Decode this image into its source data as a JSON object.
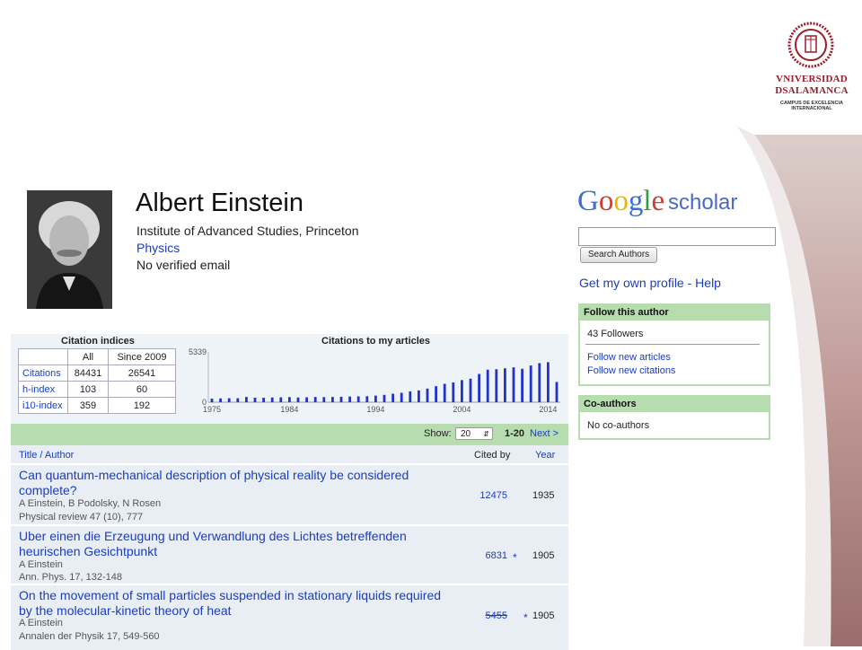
{
  "profile": {
    "name": "Albert Einstein",
    "affiliation": "Institute of Advanced Studies, Princeton",
    "field": "Physics",
    "email_status": "No verified email"
  },
  "university": {
    "line1": "VNIVERSIDAD",
    "line2": "DSALAMANCA",
    "line3": "CAMPUS DE EXCELENCIA",
    "line4": "INTERNACIONAL",
    "accent_color": "#9c1c26"
  },
  "scholar": {
    "logo_letters": [
      "G",
      "o",
      "o",
      "g",
      "l",
      "e"
    ],
    "logo_colors": [
      "#3b6fd6",
      "#d63b2f",
      "#f0b400",
      "#3b6fd6",
      "#2e9e3e",
      "#d63b2f"
    ],
    "logo_suffix": "scholar",
    "search_value": "",
    "search_button": "Search Authors",
    "own_profile": "Get my own profile",
    "separator": "-",
    "help": "Help"
  },
  "follow": {
    "header": "Follow this author",
    "followers": "43 Followers",
    "new_articles": "Follow new articles",
    "new_citations": "Follow new citations"
  },
  "coauthors": {
    "header": "Co-authors",
    "empty": "No co-authors"
  },
  "citation_indices": {
    "title": "Citation indices",
    "col_all": "All",
    "col_since": "Since 2009",
    "rows": [
      {
        "label": "Citations",
        "all": "84431",
        "since": "26541"
      },
      {
        "label": "h-index",
        "all": "103",
        "since": "60"
      },
      {
        "label": "i10-index",
        "all": "359",
        "since": "192"
      }
    ]
  },
  "chart_data": {
    "type": "bar",
    "title": "Citations to my articles",
    "ymax_label": "5339",
    "ymin_label": "0",
    "ylim": [
      0,
      5339
    ],
    "x_ticks": [
      "1975",
      "1984",
      "1994",
      "2004",
      "2014"
    ],
    "categories": [
      "1975",
      "1976",
      "1977",
      "1978",
      "1979",
      "1980",
      "1981",
      "1982",
      "1983",
      "1984",
      "1985",
      "1986",
      "1987",
      "1988",
      "1989",
      "1990",
      "1991",
      "1992",
      "1993",
      "1994",
      "1995",
      "1996",
      "1997",
      "1998",
      "1999",
      "2000",
      "2001",
      "2002",
      "2003",
      "2004",
      "2005",
      "2006",
      "2007",
      "2008",
      "2009",
      "2010",
      "2011",
      "2012",
      "2013",
      "2014"
    ],
    "values": [
      380,
      400,
      420,
      420,
      560,
      480,
      470,
      500,
      520,
      540,
      500,
      520,
      560,
      540,
      560,
      580,
      600,
      620,
      640,
      700,
      780,
      900,
      1000,
      1150,
      1250,
      1450,
      1700,
      1950,
      2100,
      2350,
      2500,
      3000,
      3450,
      3500,
      3600,
      3700,
      3550,
      3900,
      4150,
      4250,
      2150
    ],
    "bar_color": "#2233cc"
  },
  "pubs_toolbar": {
    "show_label": "Show:",
    "show_value": "20",
    "range": "1-20",
    "next": "Next >"
  },
  "pubs_header": {
    "title": "Title / Author",
    "cited_by": "Cited by",
    "year": "Year"
  },
  "publications": [
    {
      "title": "Can quantum-mechanical description of physical reality be considered complete?",
      "authors": "A Einstein, B Podolsky, N Rosen",
      "venue": "Physical review 47 (10), 777",
      "cited_by": "12475",
      "year": "1935",
      "star": ""
    },
    {
      "title": "Uber einen die Erzeugung und Verwandlung des Lichtes betreffenden heurischen Gesichtpunkt",
      "authors": "A Einstein",
      "venue": "Ann. Phys. 17, 132-148",
      "cited_by": "6831",
      "year": "1905",
      "star": "*"
    },
    {
      "title": "On the movement of small particles suspended in stationary liquids required by the molecular-kinetic theory of heat",
      "authors": "A Einstein",
      "venue": "Annalen der Physik 17, 549-560",
      "cited_by": "5455",
      "year": "1905",
      "star": "*"
    }
  ]
}
